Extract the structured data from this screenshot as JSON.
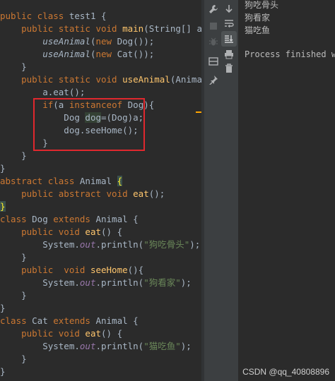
{
  "code": {
    "l1": [
      "public class ",
      "test1",
      " {"
    ],
    "l2": [
      "    public static void ",
      "main",
      "(String[] args)"
    ],
    "l3": [
      "        ",
      "useAnimal",
      "(",
      "new ",
      "Dog());"
    ],
    "l4": [
      "        ",
      "useAnimal",
      "(",
      "new ",
      "Cat());"
    ],
    "l5": "    }",
    "l6": [
      "    public static void ",
      "useAnimal",
      "(Animal a)"
    ],
    "l7": "        a.eat();",
    "l8": [
      "        ",
      "if",
      "(a ",
      "instanceof",
      " Dog){"
    ],
    "l9": [
      "            Dog ",
      "dog",
      "=(Dog)a;"
    ],
    "l10": "            dog.seeHome();",
    "l11": "        }",
    "l12": "    }",
    "l13": "}",
    "l14": [
      "abstract class ",
      "Animal ",
      "{"
    ],
    "l15": [
      "    public abstract void ",
      "eat",
      "();"
    ],
    "l16": "}",
    "l17": [
      "class ",
      "Dog ",
      "extends ",
      "Animal {"
    ],
    "l18": [
      "    public void ",
      "eat",
      "() {"
    ],
    "l19": [
      "        System.",
      "out",
      ".println(",
      "\"狗吃骨头\"",
      ");"
    ],
    "l20": "    }",
    "l21": [
      "    public  void ",
      "seeHome",
      "(){"
    ],
    "l22": [
      "        System.",
      "out",
      ".println(",
      "\"狗看家\"",
      ");"
    ],
    "l23": "    }",
    "l24": "}",
    "l25": [
      "class ",
      "Cat ",
      "extends ",
      "Animal {"
    ],
    "l26": [
      "    public void ",
      "eat",
      "() {"
    ],
    "l27": [
      "        System.",
      "out",
      ".println(",
      "\"猫吃鱼\"",
      ");"
    ],
    "l28": "    }",
    "l29": "}"
  },
  "console": {
    "outputs": [
      "狗吃骨头",
      "狗看家",
      "猫吃鱼"
    ],
    "process": "Process finished wi"
  },
  "toolbar": {
    "icons": [
      "wrench-icon",
      "arrow-down-icon",
      "stop-icon",
      "soft-wrap-icon",
      "bug-icon",
      "scroll-to-end-icon",
      "print-icon",
      "layout-icon",
      "trash-icon",
      "pin-icon"
    ]
  },
  "watermark": "CSDN @qq_40808896",
  "colors": {
    "keyword": "#cc7832",
    "function": "#ffc66d",
    "string": "#6a8759",
    "field": "#9876aa",
    "text": "#a9b7c6",
    "highlight_box": "#e0282e"
  }
}
